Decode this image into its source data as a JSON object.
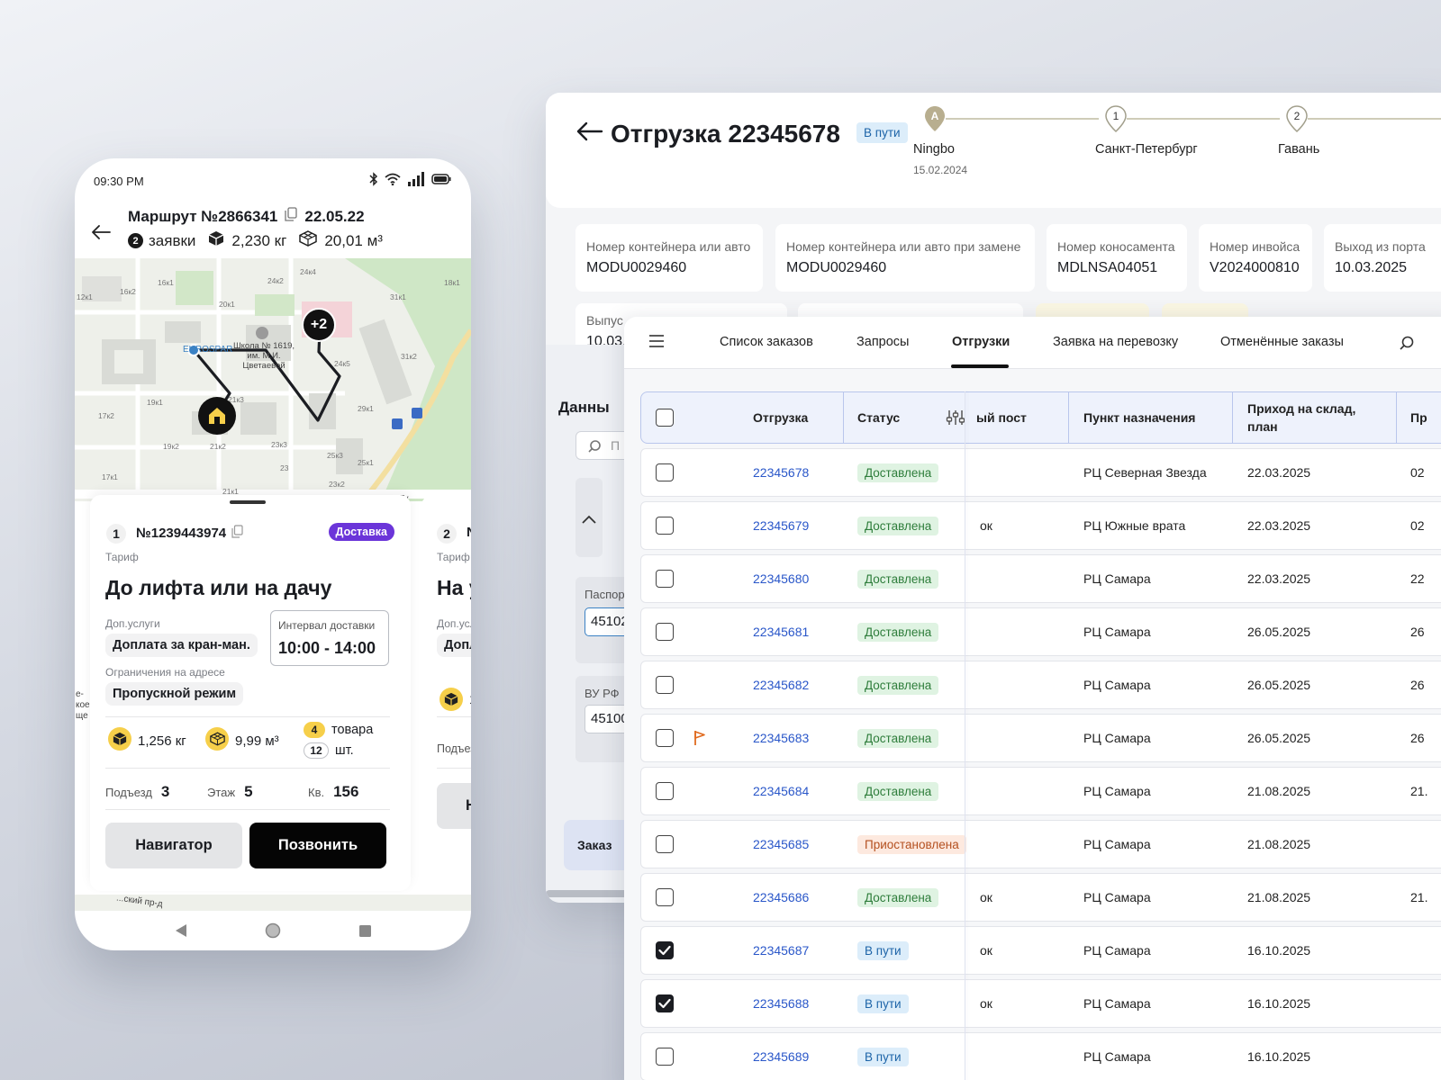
{
  "phone": {
    "time": "09:30 PM",
    "route_title": "Маршрут №2866341",
    "route_date": "22.05.22",
    "requests_count": "2",
    "requests_label": "заявки",
    "weight": "2,230 кг",
    "volume": "20,01 м³",
    "map": {
      "cluster_badge": "+2",
      "poi_school": "Школа № 1619, им. М.И. Цветаевой",
      "poi_shop": "EUROSPAR",
      "street": "...ский пр-д",
      "house_labels": [
        "16к1",
        "16к2",
        "12к1",
        "24к2",
        "24к4",
        "20к1",
        "18к1",
        "31к1",
        "31к2",
        "24к5",
        "19к1",
        "17к2",
        "21к3",
        "19к2",
        "21к2",
        "23к3",
        "29к1",
        "25к3",
        "25к1",
        "17к1",
        "23",
        "23к2",
        "21к1",
        "24к16"
      ]
    },
    "card": {
      "index": "1",
      "order": "№1239443974",
      "badge": "Доставка",
      "tariff_label": "Тариф",
      "tariff": "До лифта или на дачу",
      "extra_label": "Доп.услуги",
      "extra_value": "Доплата за кран-ман.",
      "interval_label": "Интервал доставки",
      "interval_value": "10:00 - 14:00",
      "restrict_label": "Ограничения на адресе",
      "restrict_value": "Пропускной режим",
      "weight": "1,256 кг",
      "volume": "9,99 м³",
      "goods_count": "4",
      "goods_label": "товара",
      "pcs_count": "12",
      "pcs_label": "шт.",
      "entrance_label": "Подъезд",
      "entrance": "3",
      "floor_label": "Этаж",
      "floor": "5",
      "apt_label": "Кв.",
      "apt": "156",
      "btn_nav": "Навигатор",
      "btn_call": "Позвонить"
    },
    "card2": {
      "index": "2",
      "order_partial": "N",
      "tariff_label": "Тариф",
      "tariff_partial": "На у",
      "extra_label_partial": "Доп.усл",
      "extra_value_partial": "Допл",
      "metric_partial": "1,",
      "entrance_partial": "Подъезд",
      "btn_partial": "Н"
    },
    "map_edge_labels": [
      "58",
      "е-",
      "кое",
      "ще",
      "Ту"
    ]
  },
  "desktop": {
    "title": "Отгрузка 22345678",
    "status": "В пути",
    "steps": [
      {
        "marker": "A",
        "label": "Ningbo",
        "date": "15.02.2024"
      },
      {
        "marker": "1",
        "label": "Санкт-Петербург",
        "date": ""
      },
      {
        "marker": "2",
        "label": "Гавань",
        "date": ""
      }
    ],
    "info": [
      {
        "label": "Номер контейнера или авто",
        "value": "MODU0029460"
      },
      {
        "label": "Номер контейнера или авто при замене",
        "value": "MODU0029460"
      },
      {
        "label": "Номер коносамента",
        "value": "MDLNSA04051"
      },
      {
        "label": "Номер инвойса",
        "value": "V2024000810"
      },
      {
        "label": "Выход из порта",
        "value": "10.03.2025"
      }
    ],
    "row2_label_partial": "Выпус",
    "row2_value_partial": "10.03.2",
    "data_label_partial": "Данны",
    "search_placeholder_partial": "П",
    "passport_label_partial": "Паспор",
    "passport_value_partial": "45102",
    "license_label": "ВУ РФ",
    "license_value_partial": "45100",
    "order_tab_label": "Заказ"
  },
  "table": {
    "tabs": [
      "Список заказов",
      "Запросы",
      "Отгрузки",
      "Заявка на перевозку",
      "Отменённые заказы"
    ],
    "active_tab": 2,
    "columns": [
      "Отгрузка",
      "Статус",
      "ый пост",
      "Пункт назначения",
      "Приход на склад, план",
      "Пр"
    ],
    "rows": [
      {
        "id": "22345678",
        "status": "Доставлена",
        "kind": "done",
        "post": "",
        "dest": "РЦ Северная Звезда",
        "date": "22.03.2025",
        "extra": "02",
        "checked": false,
        "flag": false
      },
      {
        "id": "22345679",
        "status": "Доставлена",
        "kind": "done",
        "post": "ок",
        "dest": "РЦ Южные врата",
        "date": "22.03.2025",
        "extra": "02",
        "checked": false,
        "flag": false
      },
      {
        "id": "22345680",
        "status": "Доставлена",
        "kind": "done",
        "post": "",
        "dest": "РЦ Самара",
        "date": "22.03.2025",
        "extra": "22",
        "checked": false,
        "flag": false
      },
      {
        "id": "22345681",
        "status": "Доставлена",
        "kind": "done",
        "post": "",
        "dest": "РЦ Самара",
        "date": "26.05.2025",
        "extra": "26",
        "checked": false,
        "flag": false
      },
      {
        "id": "22345682",
        "status": "Доставлена",
        "kind": "done",
        "post": "",
        "dest": "РЦ Самара",
        "date": "26.05.2025",
        "extra": "26",
        "checked": false,
        "flag": false
      },
      {
        "id": "22345683",
        "status": "Доставлена",
        "kind": "done",
        "post": "",
        "dest": "РЦ Самара",
        "date": "26.05.2025",
        "extra": "26",
        "checked": false,
        "flag": true
      },
      {
        "id": "22345684",
        "status": "Доставлена",
        "kind": "done",
        "post": "",
        "dest": "РЦ Самара",
        "date": "21.08.2025",
        "extra": "21.",
        "checked": false,
        "flag": false
      },
      {
        "id": "22345685",
        "status": "Приостановлена",
        "kind": "pause",
        "post": "",
        "dest": "РЦ Самара",
        "date": "21.08.2025",
        "extra": "",
        "checked": false,
        "flag": false
      },
      {
        "id": "22345686",
        "status": "Доставлена",
        "kind": "done",
        "post": "ок",
        "dest": "РЦ Самара",
        "date": "21.08.2025",
        "extra": "21.",
        "checked": false,
        "flag": false
      },
      {
        "id": "22345687",
        "status": "В пути",
        "kind": "way",
        "post": "ок",
        "dest": "РЦ Самара",
        "date": "16.10.2025",
        "extra": "",
        "checked": true,
        "flag": false
      },
      {
        "id": "22345688",
        "status": "В пути",
        "kind": "way",
        "post": "ок",
        "dest": "РЦ Самара",
        "date": "16.10.2025",
        "extra": "",
        "checked": true,
        "flag": false
      },
      {
        "id": "22345689",
        "status": "В пути",
        "kind": "way",
        "post": "",
        "dest": "РЦ Самара",
        "date": "16.10.2025",
        "extra": "",
        "checked": false,
        "flag": false
      }
    ]
  },
  "colors": {
    "accent_purple": "#6b35d9",
    "status_done_bg": "#dff3e2",
    "status_pause_bg": "#fde9df",
    "status_way_bg": "#dcedfa",
    "link": "#2a57c9"
  }
}
